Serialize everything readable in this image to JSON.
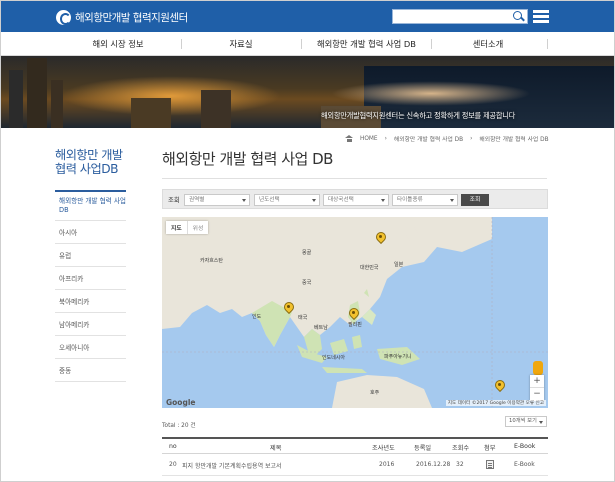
{
  "header": {
    "logo_text": "해외항만개발 협력지원센터",
    "search": {
      "placeholder": "",
      "value": ""
    }
  },
  "nav": {
    "items": [
      {
        "label": "해외 시장 정보"
      },
      {
        "label": "자료실"
      },
      {
        "label": "해외항만 개발 협력 사업 DB"
      },
      {
        "label": "센터소개"
      }
    ]
  },
  "banner": {
    "caption": "해외항만개발협력지원센터는 신속하고 정확하게 정보를 제공합니다"
  },
  "breadcrumb": {
    "home": "HOME",
    "items": [
      "해외항만 개발 협력 사업 DB",
      "해외항만 개발 협력 사업 DB"
    ]
  },
  "sidebar": {
    "title": "해외항만 개발 협력 사업DB",
    "items": [
      {
        "label": "해외항만 개발 협력 사업 DB",
        "active": true
      },
      {
        "label": "아시아"
      },
      {
        "label": "유럽"
      },
      {
        "label": "아프리카"
      },
      {
        "label": "북아메리카"
      },
      {
        "label": "남아메리카"
      },
      {
        "label": "오세아니아"
      },
      {
        "label": "중동"
      }
    ]
  },
  "main": {
    "title": "해외항만 개발 협력 사업 DB"
  },
  "filter": {
    "label": "조회",
    "selects": [
      {
        "value": "권역별"
      },
      {
        "value": "년도선택"
      },
      {
        "value": "대상국선택"
      },
      {
        "value": "타이틀종류"
      }
    ],
    "button": "조회"
  },
  "map": {
    "tabs": [
      "지도",
      "위성"
    ],
    "labels": [
      {
        "text": "몽골"
      },
      {
        "text": "중국"
      },
      {
        "text": "대한민국"
      },
      {
        "text": "일본"
      },
      {
        "text": "인도"
      },
      {
        "text": "태국"
      },
      {
        "text": "베트남"
      },
      {
        "text": "필리핀"
      },
      {
        "text": "인도네시아"
      },
      {
        "text": "파푸아뉴기니"
      },
      {
        "text": "호주"
      },
      {
        "text": "카자흐스탄"
      }
    ],
    "zoom_in": "+",
    "zoom_out": "−",
    "google": "Google",
    "attribution": "지도 데이터 ©2017 Google 이용약관 오류 신고"
  },
  "list": {
    "total": "Total : 20 건",
    "per_page": "10개씩 보기",
    "columns": [
      "no",
      "제목",
      "조사년도",
      "등록일",
      "조회수",
      "첨부",
      "E-Book"
    ],
    "rows": [
      {
        "no": "20",
        "title": "피지 항만개발 기본계획수립용역 보고서",
        "year": "2016",
        "date": "2016.12.28",
        "views": "32",
        "ebook": "E-Book"
      }
    ]
  },
  "colors": {
    "header_blue": "#1f5fa8",
    "accent_blue": "#2b5d9e",
    "pin_yellow": "#f2c12e"
  }
}
